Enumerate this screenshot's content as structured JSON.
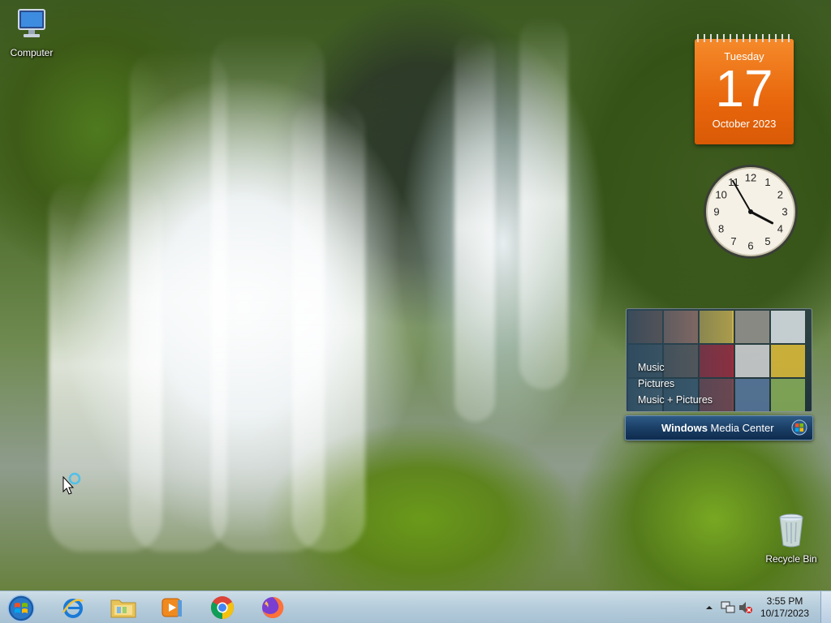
{
  "desktop": {
    "icons": {
      "computer": "Computer",
      "recycle_bin": "Recycle Bin"
    }
  },
  "calendar_gadget": {
    "weekday": "Tuesday",
    "day": "17",
    "month_year": "October 2023"
  },
  "clock_gadget": {
    "numerals": [
      "12",
      "1",
      "2",
      "3",
      "4",
      "5",
      "6",
      "7",
      "8",
      "9",
      "10",
      "11"
    ],
    "time": "3:55"
  },
  "media_center_gadget": {
    "menu": [
      "Music",
      "Pictures",
      "Music + Pictures"
    ],
    "title_bold": "Windows",
    "title_rest": " Media Center"
  },
  "taskbar": {
    "apps": [
      {
        "name": "Internet Explorer",
        "icon": "internet-explorer-icon"
      },
      {
        "name": "Windows Explorer",
        "icon": "folder-icon"
      },
      {
        "name": "Windows Media Player",
        "icon": "media-player-icon"
      },
      {
        "name": "Google Chrome",
        "icon": "chrome-icon"
      },
      {
        "name": "Firefox",
        "icon": "firefox-icon"
      }
    ],
    "clock": {
      "time": "3:55 PM",
      "date": "10/17/2023"
    },
    "tray_icons": [
      "show-hidden-icons-arrow",
      "network-icon",
      "volume-muted-icon"
    ]
  },
  "colors": {
    "calendar_orange": "#e8660c",
    "media_bar_blue": "#1b3f66",
    "taskbar": "#c2d6ea"
  }
}
